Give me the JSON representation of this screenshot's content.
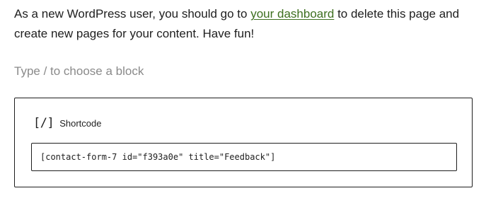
{
  "content": {
    "paragraph": {
      "text_before_link": "As a new WordPress user, you should go to ",
      "link_text": "your dashboard",
      "text_after_link": " to delete this page and create new pages for your content. Have fun!"
    },
    "appender_placeholder": "Type / to choose a block"
  },
  "shortcode_block": {
    "icon_glyph": "[/]",
    "icon_name": "shortcode-icon",
    "label": "Shortcode",
    "value": "[contact-form-7 id=\"f393a0e\" title=\"Feedback\"]"
  },
  "colors": {
    "link": "#3d6f1f",
    "placeholder": "#8a8a8a",
    "text": "#1e1e1e",
    "border": "#1e1e1e"
  }
}
